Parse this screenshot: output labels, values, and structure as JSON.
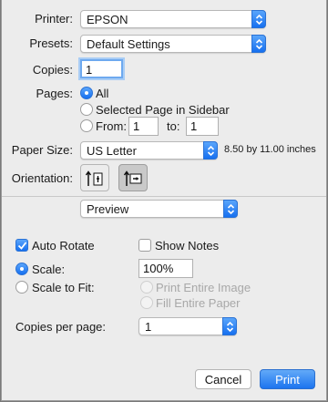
{
  "printer": {
    "label": "Printer:",
    "value": "EPSON"
  },
  "presets": {
    "label": "Presets:",
    "value": "Default Settings"
  },
  "copies": {
    "label": "Copies:",
    "value": "1"
  },
  "pages": {
    "label": "Pages:",
    "options": {
      "all": "All",
      "selected": "Selected Page in Sidebar",
      "from": "From:"
    },
    "selected_option": "all",
    "from_value": "1",
    "to_label": "to:",
    "to_value": "1"
  },
  "paper_size": {
    "label": "Paper Size:",
    "value": "US Letter",
    "dimensions": "8.50 by 11.00 inches"
  },
  "orientation": {
    "label": "Orientation:",
    "selected": "landscape"
  },
  "section_popup": {
    "value": "Preview"
  },
  "auto_rotate": {
    "label": "Auto Rotate",
    "checked": true
  },
  "show_notes": {
    "label": "Show Notes",
    "checked": false
  },
  "scale": {
    "label": "Scale:",
    "value": "100%",
    "selected": true
  },
  "scale_to_fit": {
    "label": "Scale to Fit:",
    "selected": false,
    "options": [
      "Print Entire Image",
      "Fill Entire Paper"
    ]
  },
  "copies_per_page": {
    "label": "Copies per page:",
    "value": "1"
  },
  "buttons": {
    "cancel": "Cancel",
    "print": "Print"
  },
  "colors": {
    "accent": "#1670f0",
    "background": "#ececec"
  },
  "icons": {
    "popup_arrows": "updown-chevron-icon",
    "portrait": "portrait-orientation-icon",
    "landscape": "landscape-orientation-icon",
    "checkmark": "checkmark-icon"
  }
}
